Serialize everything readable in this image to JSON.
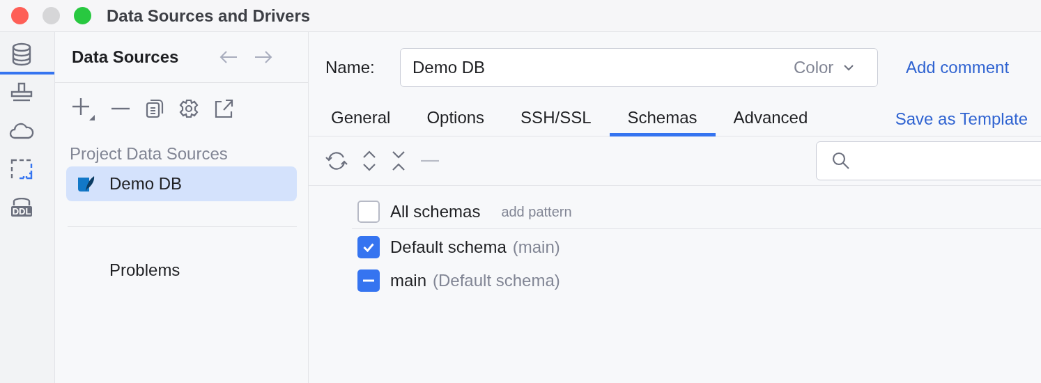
{
  "window": {
    "title": "Data Sources and Drivers"
  },
  "tool_strip": [
    {
      "kind": "database",
      "selected": true
    },
    {
      "kind": "stamp",
      "selected": false
    },
    {
      "kind": "cloud",
      "selected": false
    },
    {
      "kind": "frame",
      "selected": false
    },
    {
      "kind": "ddl",
      "label": "DDL",
      "selected": false
    }
  ],
  "sidebar": {
    "title": "Data Sources",
    "group": "Project Data Sources",
    "items": [
      {
        "label": "Demo DB",
        "selected": true
      }
    ],
    "problems": "Problems"
  },
  "main": {
    "name_label": "Name:",
    "name_value": "Demo DB",
    "color_label": "Color",
    "add_comment": "Add comment",
    "tabs": [
      {
        "label": "General",
        "selected": false
      },
      {
        "label": "Options",
        "selected": false
      },
      {
        "label": "SSH/SSL",
        "selected": false
      },
      {
        "label": "Schemas",
        "selected": true
      },
      {
        "label": "Advanced",
        "selected": false
      }
    ],
    "save_template": "Save as Template",
    "schemas": [
      {
        "label": "All schemas",
        "hint": "add pattern",
        "checked": false,
        "indeterminate": false
      },
      {
        "label": "Default schema",
        "note": "(main)",
        "checked": true,
        "indeterminate": false
      },
      {
        "label": "main",
        "note": "(Default schema)",
        "checked": false,
        "indeterminate": true
      }
    ]
  }
}
